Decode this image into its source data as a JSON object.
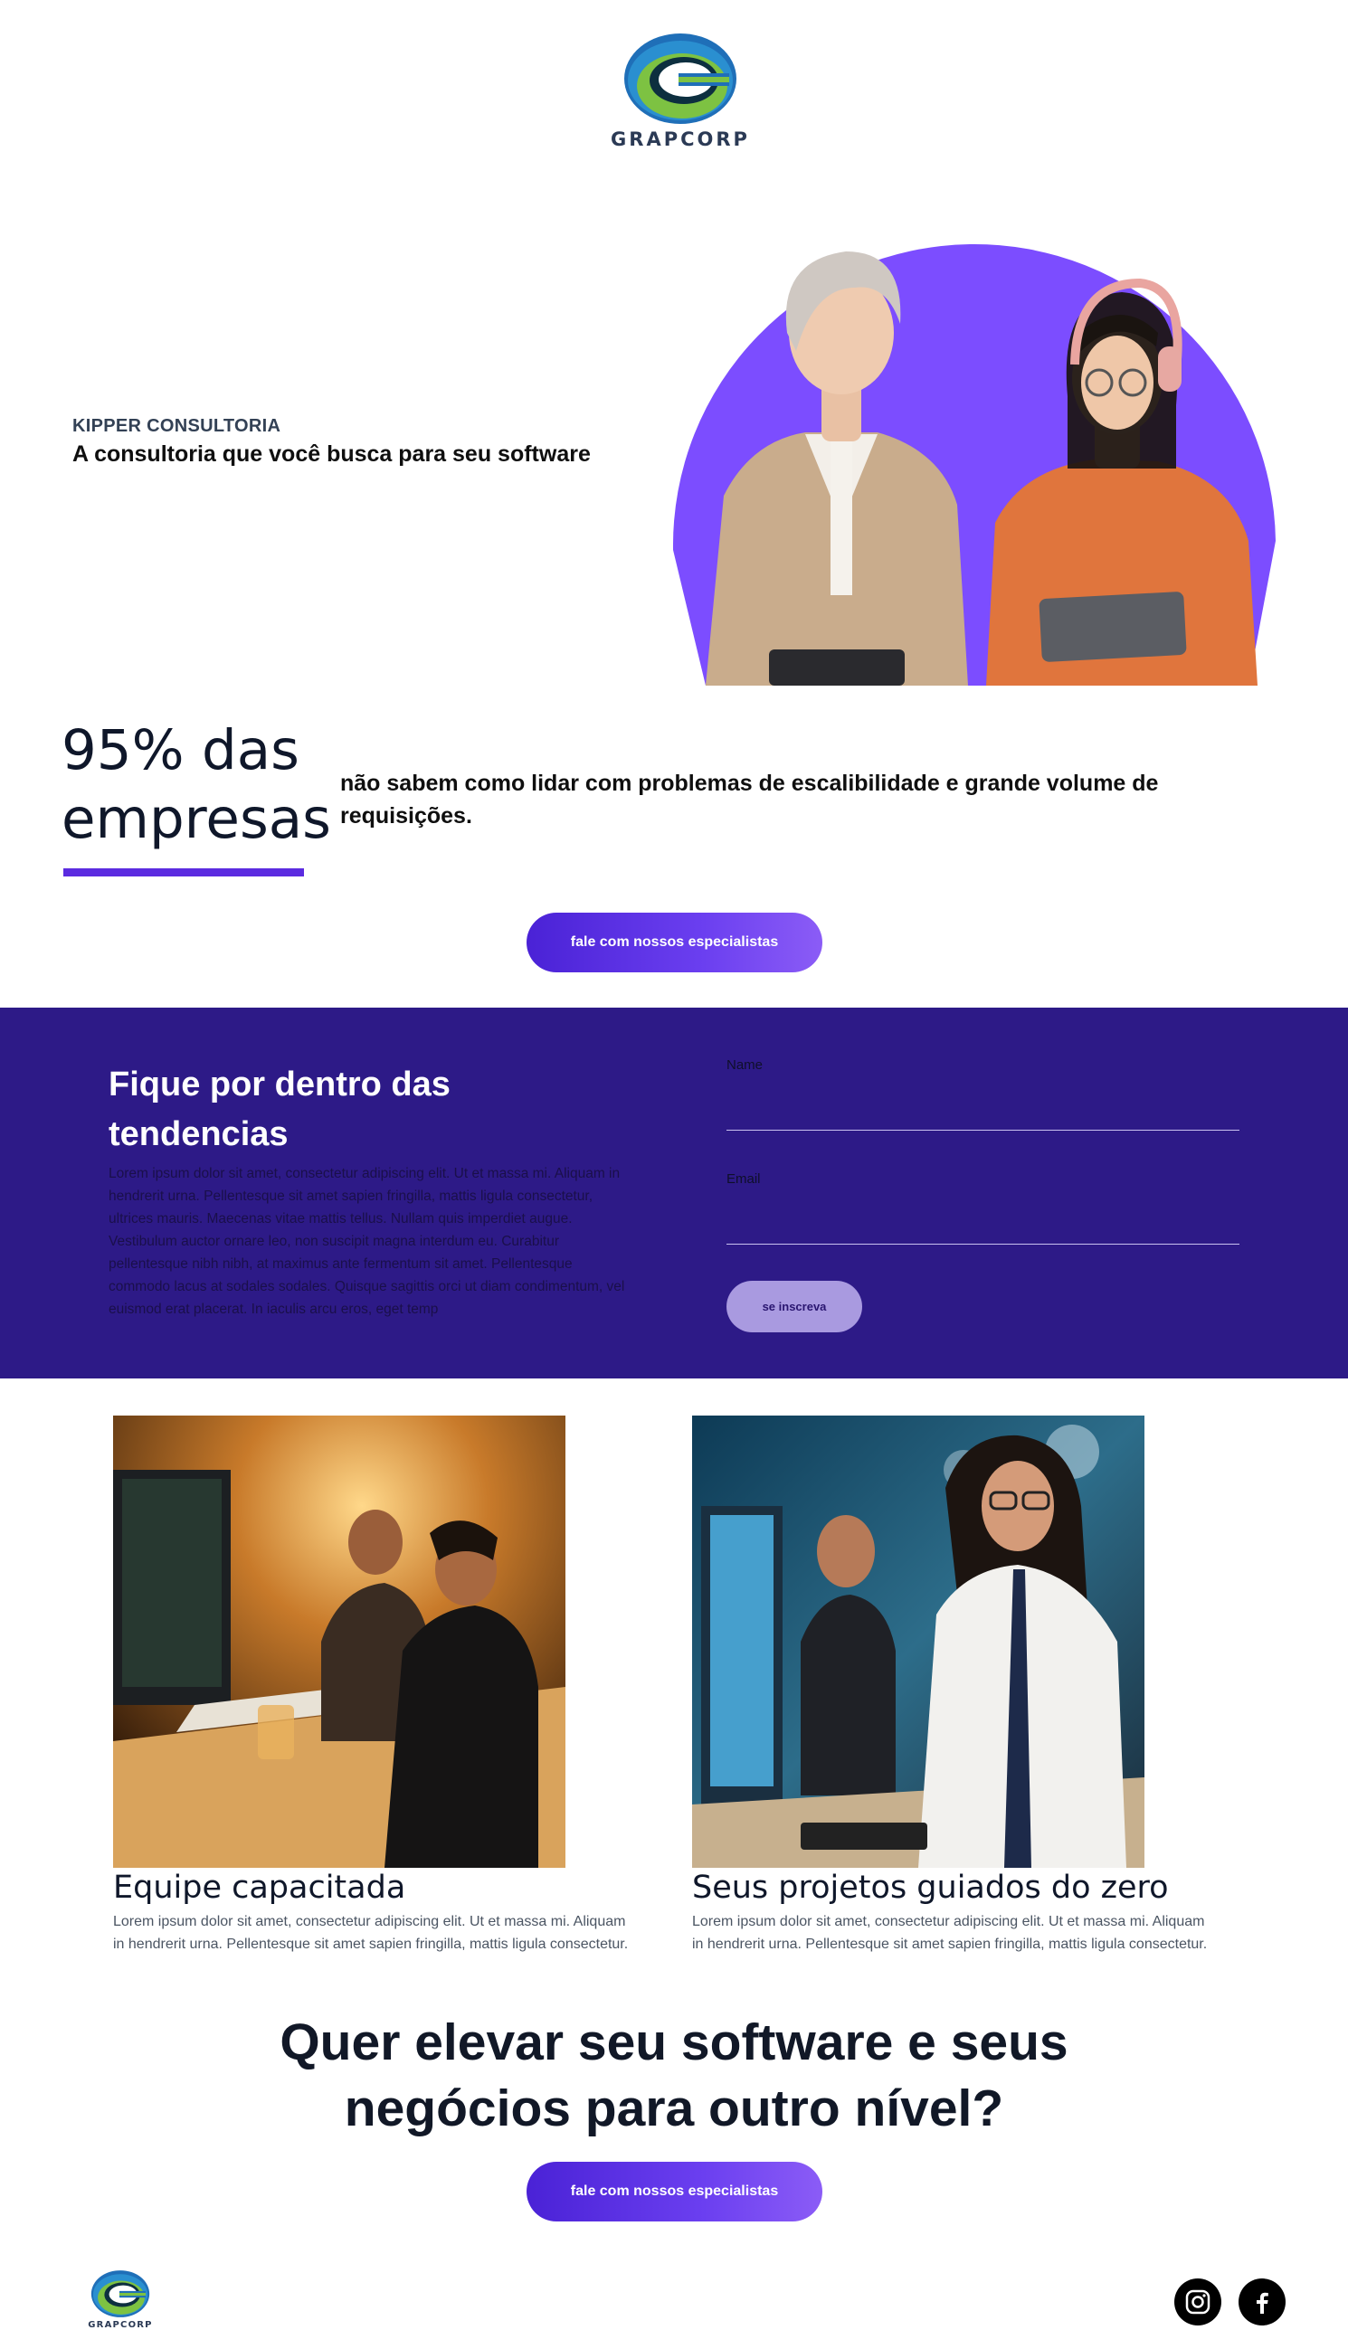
{
  "header": {
    "logo_text": "GRAPCORP"
  },
  "hero": {
    "kicker": "KIPPER CONSULTORIA",
    "title": "A consultoria que você busca para seu software"
  },
  "stat": {
    "big_line1": "95% das",
    "big_line2": "empresas",
    "text": "não sabem como lidar com problemas de escalibilidade e grande volume de requisições."
  },
  "cta_primary": "fale com nossos especialistas",
  "newsletter": {
    "title": "Fique por dentro das tendencias",
    "body": "Lorem ipsum dolor sit amet, consectetur adipiscing elit. Ut et massa mi. Aliquam in hendrerit urna. Pellentesque sit amet sapien fringilla, mattis ligula consectetur, ultrices mauris. Maecenas vitae mattis tellus. Nullam quis imperdiet augue. Vestibulum auctor ornare leo, non suscipit magna interdum eu. Curabitur pellentesque nibh nibh, at maximus ante fermentum sit amet. Pellentesque commodo lacus at sodales sodales. Quisque sagittis orci ut diam condimentum, vel euismod erat placerat. In iaculis arcu eros, eget temp",
    "name_label": "Name",
    "name_value": "",
    "email_label": "Email",
    "email_value": "",
    "subscribe_label": "se inscreva"
  },
  "features": [
    {
      "title": "Equipe capacitada",
      "text": "Lorem ipsum dolor sit amet, consectetur adipiscing elit. Ut et massa mi. Aliquam in hendrerit urna. Pellentesque sit amet sapien fringilla, mattis ligula consectetur."
    },
    {
      "title": "Seus projetos guiados do zero",
      "text": "Lorem ipsum dolor sit amet, consectetur adipiscing elit. Ut et massa mi. Aliquam in hendrerit urna. Pellentesque sit amet sapien fringilla, mattis ligula consectetur."
    }
  ],
  "closing": {
    "title": "Quer elevar seu software e seus negócios para outro nível?",
    "cta": "fale com nossos especialistas"
  },
  "footer": {
    "logo_text": "GRAPCORP",
    "social": [
      {
        "icon": "instagram-icon"
      },
      {
        "icon": "facebook-icon"
      }
    ]
  },
  "colors": {
    "accent": "#5b2be0",
    "band": "#2d1a87",
    "hero_circle": "#7c4dff",
    "logo_blue": "#1f6fb8",
    "logo_green": "#7dc242"
  }
}
